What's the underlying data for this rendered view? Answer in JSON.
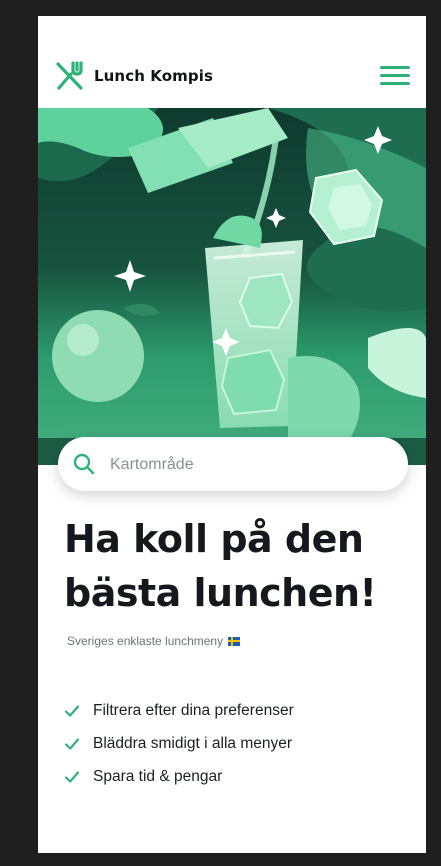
{
  "header": {
    "brand": "Lunch Kompis",
    "logo_icon": "fork-knife-icon",
    "menu_icon": "hamburger-menu-icon",
    "accent_color": "#2fb17a"
  },
  "search": {
    "placeholder": "Kartområde",
    "icon": "search-icon"
  },
  "hero": {
    "headline_line1": "Ha koll på den",
    "headline_line2": "bästa lunchen!",
    "subtitle": "Sveriges enklaste lunchmeny",
    "subtitle_icon": "swedish-flag-icon"
  },
  "features": [
    {
      "label": "Filtrera efter dina preferenser",
      "icon": "check-icon"
    },
    {
      "label": "Bläddra smidigt i alla menyer",
      "icon": "check-icon"
    },
    {
      "label": "Spara tid & pengar",
      "icon": "check-icon"
    }
  ]
}
